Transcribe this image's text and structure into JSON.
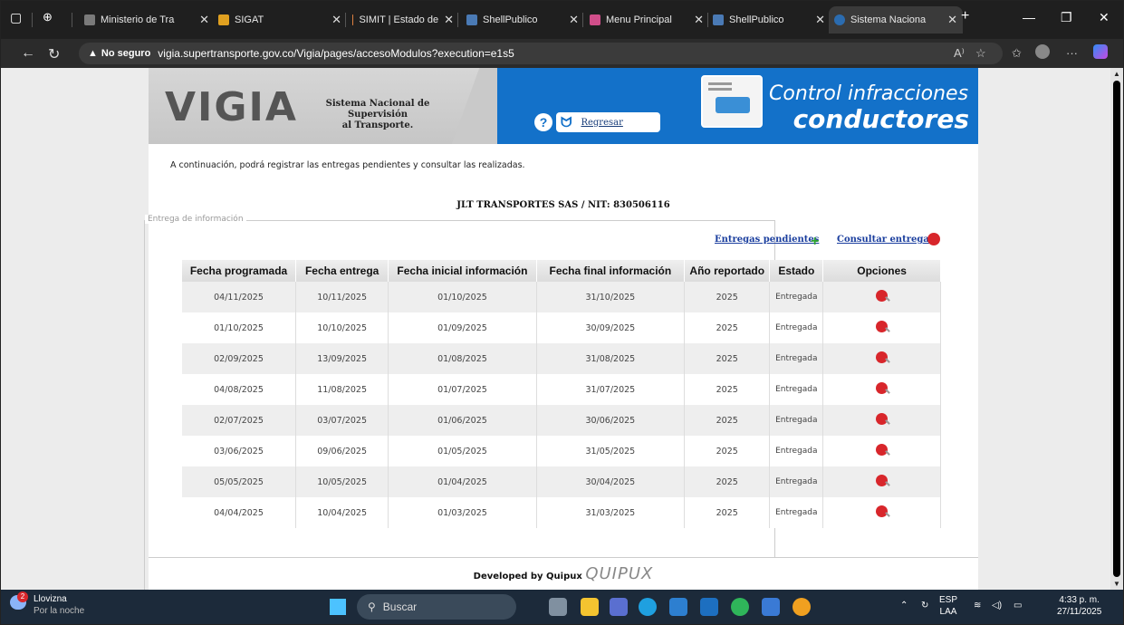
{
  "browser": {
    "tabs": [
      {
        "label": "Ministerio de Tra",
        "color": "#7a7a7a"
      },
      {
        "label": "SIGAT",
        "color": "#e0a020"
      },
      {
        "label": "SIMIT | Estado de",
        "color": "#e08040"
      },
      {
        "label": "ShellPublico",
        "color": "#4a7ab5"
      },
      {
        "label": "Menu Principal",
        "color": "#d04e8a"
      },
      {
        "label": "ShellPublico",
        "color": "#4a7ab5"
      },
      {
        "label": "Sistema Naciona",
        "color": "#2b6cb0"
      }
    ],
    "not_secure": "No seguro",
    "url": "vigia.supertransporte.gov.co/Vigia/pages/accesoModulos?execution=e1s5"
  },
  "header": {
    "logo": "VIGIA",
    "subtitle_line1": "Sistema Nacional de Supervisión",
    "subtitle_line2": "al Transporte.",
    "help": "?",
    "back_label": "Regresar",
    "title_line1": "Control infracciones",
    "title_line2": "conductores"
  },
  "intro": "A continuación, podrá registrar las entregas pendientes y consultar las realizadas.",
  "company": "JLT TRANSPORTES SAS / NIT: 830506116",
  "section": {
    "legend": "Entrega de información",
    "pending_link": "Entregas pendientes",
    "consult_link": "Consultar entregas"
  },
  "table": {
    "headers": [
      "Fecha programada",
      "Fecha entrega",
      "Fecha inicial información",
      "Fecha final información",
      "Año reportado",
      "Estado",
      "Opciones"
    ],
    "rows": [
      [
        "04/11/2025",
        "10/11/2025",
        "01/10/2025",
        "31/10/2025",
        "2025",
        "Entregada"
      ],
      [
        "01/10/2025",
        "10/10/2025",
        "01/09/2025",
        "30/09/2025",
        "2025",
        "Entregada"
      ],
      [
        "02/09/2025",
        "13/09/2025",
        "01/08/2025",
        "31/08/2025",
        "2025",
        "Entregada"
      ],
      [
        "04/08/2025",
        "11/08/2025",
        "01/07/2025",
        "31/07/2025",
        "2025",
        "Entregada"
      ],
      [
        "02/07/2025",
        "03/07/2025",
        "01/06/2025",
        "30/06/2025",
        "2025",
        "Entregada"
      ],
      [
        "03/06/2025",
        "09/06/2025",
        "01/05/2025",
        "31/05/2025",
        "2025",
        "Entregada"
      ],
      [
        "05/05/2025",
        "10/05/2025",
        "01/04/2025",
        "30/04/2025",
        "2025",
        "Entregada"
      ],
      [
        "04/04/2025",
        "10/04/2025",
        "01/03/2025",
        "31/03/2025",
        "2025",
        "Entregada"
      ]
    ]
  },
  "footer": {
    "developed": "Developed by Quipux",
    "brand": "QUIPUX"
  },
  "taskbar": {
    "weather_title": "Llovizna",
    "weather_sub": "Por la noche",
    "weather_badge": "2",
    "search": "Buscar",
    "lang1": "ESP",
    "lang2": "LAA",
    "time": "4:33 p. m.",
    "date": "27/11/2025"
  }
}
